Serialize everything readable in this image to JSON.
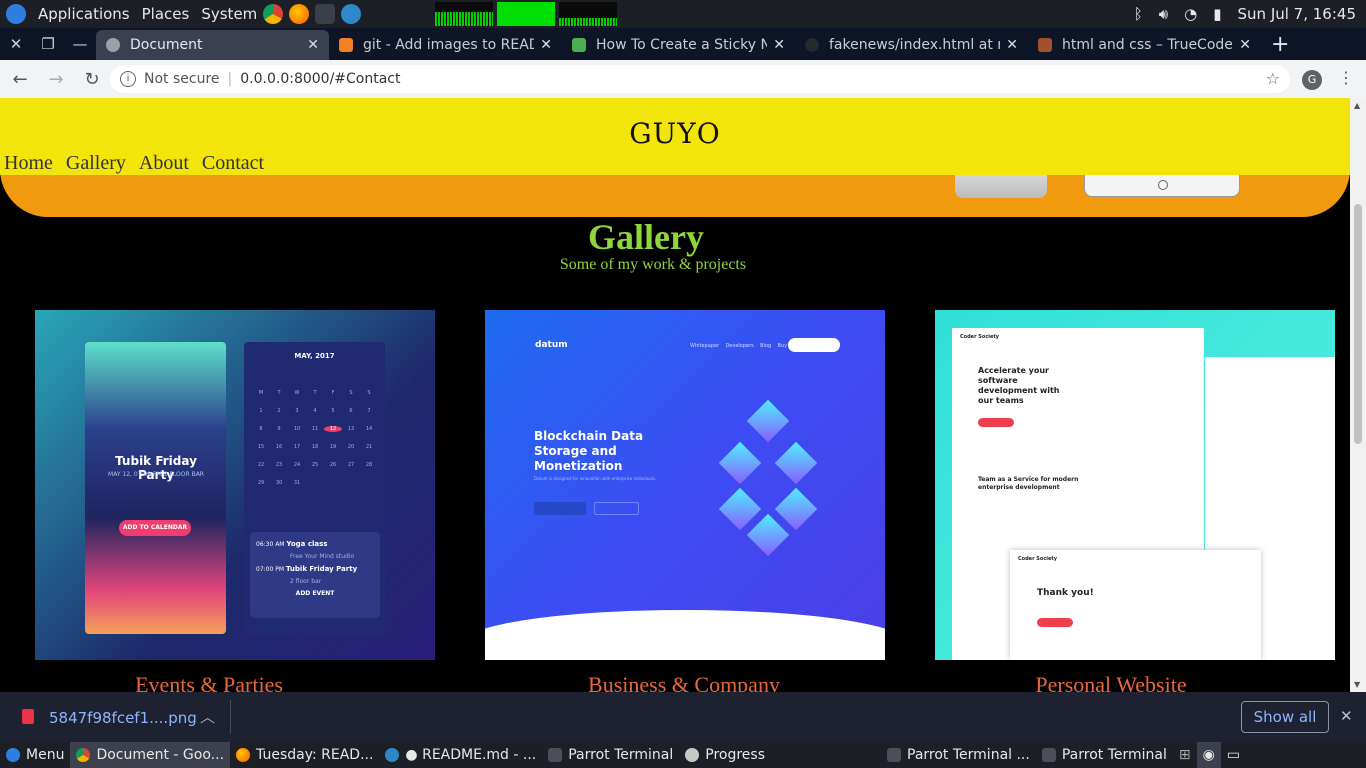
{
  "os_panel": {
    "applications": "Applications",
    "places": "Places",
    "system": "System",
    "datetime": "Sun Jul 7, 16:45"
  },
  "tabs": [
    {
      "title": "Document",
      "favicon": "chrome-doc-icon",
      "active": true
    },
    {
      "title": "git - Add images to READ",
      "favicon": "stackoverflow-icon",
      "active": false
    },
    {
      "title": "How To Create a Sticky N",
      "favicon": "w3schools-icon",
      "active": false
    },
    {
      "title": "fakenews/index.html at m",
      "favicon": "github-icon",
      "active": false
    },
    {
      "title": "html and css – TrueCode",
      "favicon": "truecode-icon",
      "active": false
    }
  ],
  "address_bar": {
    "security": "Not secure",
    "url": "0.0.0.0:8000/#Contact",
    "profile_initial": "G"
  },
  "site": {
    "logo": "GUYO",
    "nav": [
      "Home",
      "Gallery",
      "About",
      "Contact"
    ],
    "header_color": "#f3e40c",
    "band_color": "#f29a0f"
  },
  "gallery": {
    "title": "Gallery",
    "subtitle": "Some of my work & projects",
    "accent": "#8fd63c",
    "caption_color": "#e9673a",
    "items": [
      {
        "caption": "Events & Parties",
        "event_title": "Tubik Friday Party",
        "event_sub": "MAY 12, 07:00 PM   2 FLOOR BAR",
        "cta": "ADD TO CALENDAR",
        "month": "MAY, 2017",
        "weekdays": [
          "M",
          "T",
          "W",
          "T",
          "F",
          "S",
          "S"
        ],
        "days": [
          "1",
          "2",
          "3",
          "4",
          "5",
          "6",
          "7",
          "8",
          "9",
          "10",
          "11",
          "12",
          "13",
          "14",
          "15",
          "16",
          "17",
          "18",
          "19",
          "20",
          "21",
          "22",
          "23",
          "24",
          "25",
          "26",
          "27",
          "28",
          "29",
          "30",
          "31"
        ],
        "selected_day": "12",
        "events": [
          {
            "time": "06:30 AM",
            "name": "Yoga class",
            "place": "Free Your Mind studio"
          },
          {
            "time": "07:00 PM",
            "name": "Tubik Friday Party",
            "place": "2 floor bar"
          }
        ],
        "add_event": "ADD EVENT"
      },
      {
        "caption": "Business & Company",
        "brand": "datum",
        "headline": "Blockchain Data Storage and Monetization",
        "blurb": "Datum is designed for innovation with enterprise individuals."
      },
      {
        "caption": "Personal Website",
        "brand": "Coder Society",
        "headline": "Accelerate your software development with our teams",
        "section": "Team as a Service for modern enterprise development",
        "thanks": "Thank you!"
      }
    ]
  },
  "download_shelf": {
    "file": "5847f98fcef1....png",
    "show_all": "Show all"
  },
  "taskbar": [
    {
      "label": "Menu",
      "icon": "parrot-icon",
      "active": false
    },
    {
      "label": "Document - Goo...",
      "icon": "chrome-icon",
      "active": true
    },
    {
      "label": "Tuesday: READ...",
      "icon": "firefox-icon",
      "active": false
    },
    {
      "label": "● README.md - ...",
      "icon": "vscode-icon",
      "active": false
    },
    {
      "label": "Parrot Terminal",
      "icon": "terminal-icon",
      "active": false
    },
    {
      "label": "Progress",
      "icon": "progress-icon",
      "active": false
    },
    {
      "label": "Parrot Terminal ...",
      "icon": "terminal-icon",
      "active": false
    },
    {
      "label": "Parrot Terminal",
      "icon": "terminal-icon",
      "active": false
    }
  ]
}
